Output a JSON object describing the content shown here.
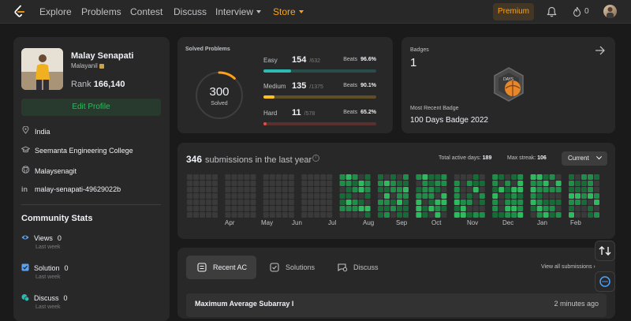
{
  "nav": {
    "items": [
      "Explore",
      "Problems",
      "Contest",
      "Discuss",
      "Interview",
      "Store"
    ],
    "premium": "Premium",
    "streak_count": "0",
    "accent": "#ffa116"
  },
  "profile": {
    "name": "Malay Senapati",
    "username": "Malayanil",
    "rank_label": "Rank",
    "rank_value": "166,140",
    "edit_button": "Edit Profile",
    "location": "India",
    "school": "Seemanta Engineering College",
    "github": "Malaysenagit",
    "linkedin": "malay-senapati-49629022b",
    "icons": [
      "location-icon",
      "graduation-cap-icon",
      "github-icon",
      "linkedin-icon"
    ]
  },
  "community": {
    "title": "Community Stats",
    "stats": [
      {
        "label": "Views",
        "value": "0",
        "sub": "Last week",
        "icon": "eye-icon",
        "color": "#5ba3f0"
      },
      {
        "label": "Solution",
        "value": "0",
        "sub": "Last week",
        "icon": "solution-icon",
        "color": "#5ba3f0"
      },
      {
        "label": "Discuss",
        "value": "0",
        "sub": "Last week",
        "icon": "discuss-icon",
        "color": "#2cbbb0"
      }
    ]
  },
  "solved": {
    "title": "Solved Problems",
    "total": "300",
    "total_label": "Solved",
    "beats_label": "Beats",
    "difficulties": [
      {
        "name": "Easy",
        "count": "154",
        "total": "/632",
        "beats": "96.6%",
        "fraction": 0.244,
        "color": "#2cbbb0",
        "track": "#2cbbb040"
      },
      {
        "name": "Medium",
        "count": "135",
        "total": "/1375",
        "beats": "90.1%",
        "fraction": 0.098,
        "color": "#ffc01e",
        "track": "#ffc01e40"
      },
      {
        "name": "Hard",
        "count": "11",
        "total": "/578",
        "beats": "65.2%",
        "fraction": 0.019,
        "color": "#ef4743",
        "track": "#ef474340"
      }
    ]
  },
  "badges": {
    "title": "Badges",
    "count": "1",
    "recent_label": "Most Recent Badge",
    "recent_name": "100 Days Badge 2022",
    "badge_text": "DAYS"
  },
  "submissions": {
    "count": "346",
    "label": "submissions in the last year",
    "active_days_label": "Total active days:",
    "active_days": "189",
    "max_streak_label": "Max streak:",
    "max_streak": "106",
    "period": "Current",
    "months": [
      "Apr",
      "May",
      "Jun",
      "Jul",
      "Aug",
      "Sep",
      "Oct",
      "Nov",
      "Dec",
      "Jan",
      "Feb"
    ]
  },
  "recent": {
    "tabs": [
      "Recent AC",
      "Solutions",
      "Discuss"
    ],
    "view_all": "View all submissions",
    "items": [
      {
        "title": "Maximum Average Subarray I",
        "time": "2 minutes ago"
      }
    ]
  }
}
